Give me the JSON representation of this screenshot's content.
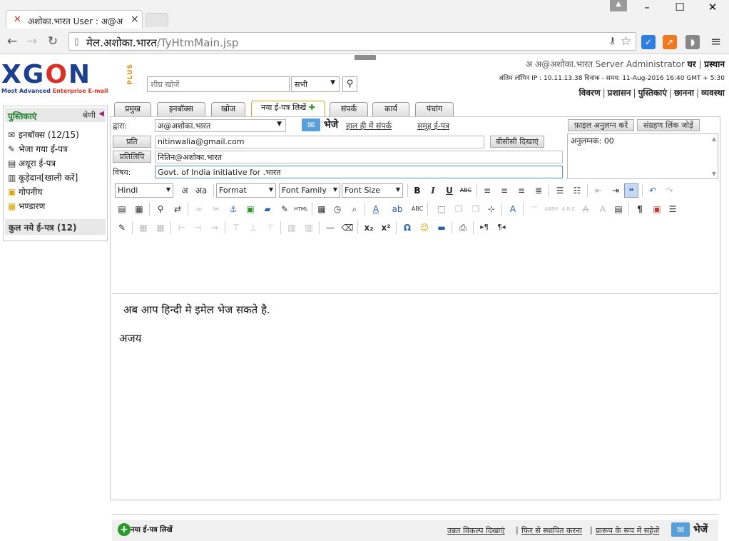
{
  "browser": {
    "tab_title": "अशोका.भारत User : अ@अ",
    "url_host": "मेल.अशोका.भारत",
    "url_path": "/TyHtmMain.jsp"
  },
  "header": {
    "logo": {
      "word_left": "XG",
      "word_o": "O",
      "word_right": "N",
      "plus": "PLUS",
      "tag_a": "Most Advanced ",
      "tag_b": "Enterprise E-mail"
    },
    "quick_search_placeholder": "शीघ्र खोजें",
    "search_scope": "सभी",
    "user_name": "अ अ@अशोका.भारत Server Administrator",
    "home_link": "घर",
    "logout_link": "प्रस्थान",
    "last_login": "अंतिम लॉगिन IP : 10.11.13.38 दिनांक - समय: 11-Aug-2016 16:40 GMT + 5:30",
    "links": [
      "विवरण",
      "प्रशासन",
      "पुस्तिकाएं",
      "छानना",
      "व्यवस्था"
    ]
  },
  "sidebar": {
    "title": "पुस्तिकाएं",
    "category": "श्रेणी",
    "folders": [
      {
        "label": "इनबॉक्स (12/15)",
        "icon": "inbox-icon"
      },
      {
        "label": "भेजा गया ई-पत्र",
        "icon": "sent-icon"
      },
      {
        "label": "अधूरा ई-पत्र",
        "icon": "draft-icon"
      },
      {
        "label": "कूड़ेदान[खाली करें]",
        "icon": "trash-icon"
      },
      {
        "label": "गोपनीय",
        "icon": "lock-icon"
      },
      {
        "label": "भण्डारण",
        "icon": "storage-icon"
      }
    ],
    "footer": "कुल नये ई-पत्र (12)"
  },
  "tabs": [
    {
      "label": "प्रमुख"
    },
    {
      "label": "इनबॉक्स"
    },
    {
      "label": "खोज"
    },
    {
      "label": "नया ई-पत्र लिखें",
      "active": true
    },
    {
      "label": "संपर्क"
    },
    {
      "label": "कार्य"
    },
    {
      "label": "पंचांग"
    }
  ],
  "compose": {
    "from_label": "द्वारा:",
    "from_value": "अ@अशोका.भारत",
    "send_label": "भेजे",
    "recent_contacts": "हाल ही में संपर्क",
    "group_mail": "समूह ई-पत्र",
    "to_button": "प्रति",
    "to_value": "nitinwalia@gmail.com",
    "bcc_button": "बीसीसी  दिखाएं",
    "cc_button": "प्रतिलिपि",
    "cc_value": "नितिन@अशोका.भारत",
    "subject_label": "विषय:",
    "subject_value": "Govt. of India initiative for .भारत",
    "attach_file": "फ़ाइल अनुलग्न करें",
    "attach_link": "संग्रहण लिंक जोड़ें",
    "attachments_text": "अनुलग्नक: 00"
  },
  "toolbar": {
    "language": "Hindi",
    "format": "Format",
    "font_family": "Font Family",
    "font_size": "Font Size"
  },
  "editor": {
    "line1": "अब आप  हिन्दी मे इमेल भेज सकते है.",
    "line2": "अजय"
  },
  "footer": {
    "new_mail": "नया ई-पत्र लिखें",
    "advanced": "उन्नत विकल्प दिखाएं",
    "reset": "फिर से स्थापित करना",
    "save_draft": "प्रारूप के रूप में सहेजें",
    "send": "भेजें"
  }
}
